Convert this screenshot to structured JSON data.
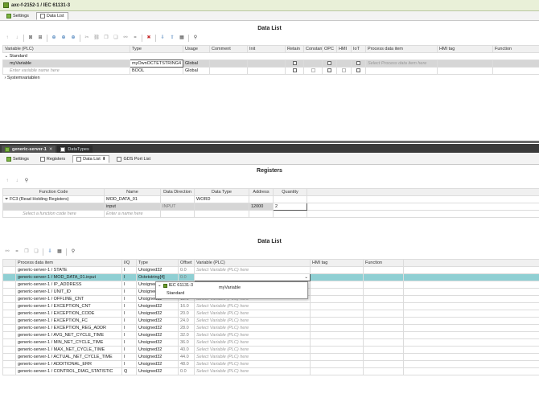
{
  "top_window": {
    "title": "axc-f-2152-1 / IEC 61131-3",
    "tabs": [
      {
        "label": "Settings"
      },
      {
        "label": "Data List"
      }
    ],
    "section_title": "Data List",
    "columns": [
      "Variable (PLC)",
      "Type",
      "Usage",
      "Comment",
      "Init",
      "Retain",
      "Constant",
      "OPC",
      "HMI",
      "IoT",
      "Process data item",
      "HMI tag",
      "Function"
    ],
    "group_standard": "Standard",
    "row1": {
      "name": "myVariable",
      "type": "myOwnOCTETSTRING4",
      "usage": "Global",
      "process_placeholder": "Select Process data item here"
    },
    "row2": {
      "name_placeholder": "Enter variable name here",
      "type": "BOOL",
      "usage": "Global"
    },
    "group_system": "Systemvariablen"
  },
  "bottom_window": {
    "tabs": [
      {
        "label": "generic-server-1"
      },
      {
        "label": "DataTypes"
      }
    ],
    "subtabs": [
      {
        "label": "Settings"
      },
      {
        "label": "Registers"
      },
      {
        "label": "Data List"
      },
      {
        "label": "GDS Port List"
      }
    ],
    "registers": {
      "title": "Registers",
      "columns": [
        "Function Code",
        "Name",
        "Data Direction",
        "Data Type",
        "Address",
        "Quantity"
      ],
      "row1": {
        "function_code": "FC3 (Read Holding Registers)",
        "name": "MOD_DATA_01",
        "data_direction": "",
        "data_type": "WORD",
        "address": "",
        "quantity": ""
      },
      "row2": {
        "function_code": "",
        "name": "input",
        "data_direction": "INPUT",
        "data_type": "",
        "address": "12000",
        "quantity": "2"
      },
      "row3": {
        "function_code_placeholder": "Select a function code here",
        "name_placeholder": "Enter a name here"
      }
    },
    "datalist": {
      "title": "Data List",
      "columns": [
        "Process data item",
        "I/Q",
        "Type",
        "Offset",
        "Variable (PLC)",
        "HMI tag",
        "Function"
      ],
      "var_placeholder": "Select Variable (PLC) here",
      "rows": [
        {
          "item": "generic-server-1 / STATE",
          "iq": "I",
          "type": "Unsigned32",
          "offset": "0.0"
        },
        {
          "item": "generic-server-1 / MOD_DATA_01.input",
          "iq": "I",
          "type": "Octetstring[4]",
          "offset": "0.0"
        },
        {
          "item": "generic-server-1 / IP_ADDRESS",
          "iq": "I",
          "type": "Unsigned",
          "offset": ""
        },
        {
          "item": "generic-server-1 / UNIT_ID",
          "iq": "I",
          "type": "Unsigned",
          "offset": ""
        },
        {
          "item": "generic-server-1 / OFFLINE_CNT",
          "iq": "I",
          "type": "Unsigned32",
          "offset": "12.0"
        },
        {
          "item": "generic-server-1 / EXCEPTION_CNT",
          "iq": "I",
          "type": "Unsigned32",
          "offset": "16.0"
        },
        {
          "item": "generic-server-1 / EXCEPTION_CODE",
          "iq": "I",
          "type": "Unsigned32",
          "offset": "20.0"
        },
        {
          "item": "generic-server-1 / EXCEPTION_FC",
          "iq": "I",
          "type": "Unsigned32",
          "offset": "24.0"
        },
        {
          "item": "generic-server-1 / EXCEPTION_REG_ADDR",
          "iq": "I",
          "type": "Unsigned32",
          "offset": "28.0"
        },
        {
          "item": "generic-server-1 / AVG_NET_CYCLE_TIME",
          "iq": "I",
          "type": "Unsigned32",
          "offset": "32.0"
        },
        {
          "item": "generic-server-1 / MIN_NET_CYCLE_TIME",
          "iq": "I",
          "type": "Unsigned32",
          "offset": "36.0"
        },
        {
          "item": "generic-server-1 / MAX_NET_CYCLE_TIME",
          "iq": "I",
          "type": "Unsigned32",
          "offset": "40.0"
        },
        {
          "item": "generic-server-1 / ACTUAL_NET_CYCLE_TIME",
          "iq": "I",
          "type": "Unsigned32",
          "offset": "44.0"
        },
        {
          "item": "generic-server-1 / ADDITIONAL_ERR",
          "iq": "I",
          "type": "Unsigned32",
          "offset": "48.0"
        },
        {
          "item": "generic-server-1 / CONTROL_DIAG_STATISTIC",
          "iq": "Q",
          "type": "Unsigned32",
          "offset": "0.0"
        }
      ]
    },
    "dropdown": {
      "header": "IEC 61131-3",
      "group": "Standard",
      "item": "myVariable"
    }
  },
  "colors": {
    "accent_teal": "#8fcfd3",
    "title_bar": "#e9f0d8",
    "dark_bar": "#3a3a3a"
  }
}
